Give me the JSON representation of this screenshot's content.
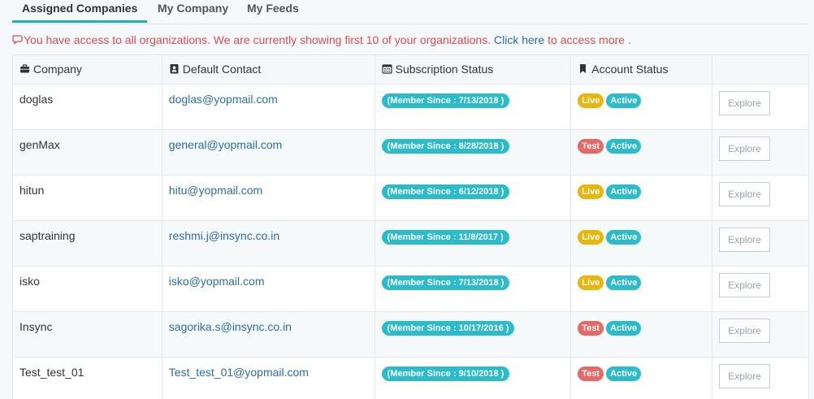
{
  "tabs": [
    {
      "label": "Assigned Companies",
      "active": true
    },
    {
      "label": "My Company",
      "active": false
    },
    {
      "label": "My Feeds",
      "active": false
    }
  ],
  "notice": {
    "text": "You have access to all organizations. We are currently showing first 10 of your organizations.",
    "link_text": "Click here",
    "suffix": "to access more ."
  },
  "table": {
    "headers": {
      "company": "Company",
      "contact": "Default Contact",
      "subscription": "Subscription Status",
      "account": "Account Status",
      "action": ""
    },
    "rows": [
      {
        "company": "doglas",
        "email": "doglas@yopmail.com",
        "member": "(Member Since : 7/13/2018 )",
        "env": "Live",
        "status": "Active",
        "action": "Explore"
      },
      {
        "company": "genMax",
        "email": "general@yopmail.com",
        "member": "(Member Since : 8/28/2018 )",
        "env": "Test",
        "status": "Active",
        "action": "Explore"
      },
      {
        "company": "hitun",
        "email": "hitu@yopmail.com",
        "member": "(Member Since : 6/12/2018 )",
        "env": "Live",
        "status": "Active",
        "action": "Explore"
      },
      {
        "company": "saptraining",
        "email": "reshmi.j@insync.co.in",
        "member": "(Member Since : 11/8/2017 )",
        "env": "Live",
        "status": "Active",
        "action": "Explore"
      },
      {
        "company": "isko",
        "email": "isko@yopmail.com",
        "member": "(Member Since : 7/13/2018 )",
        "env": "Live",
        "status": "Active",
        "action": "Explore"
      },
      {
        "company": "Insync",
        "email": "sagorika.s@insync.co.in",
        "member": "(Member Since : 10/17/2016 )",
        "env": "Test",
        "status": "Active",
        "action": "Explore"
      },
      {
        "company": "Test_test_01",
        "email": "Test_test_01@yopmail.com",
        "member": "(Member Since : 9/10/2018 )",
        "env": "Test",
        "status": "Active",
        "action": "Explore"
      }
    ]
  },
  "colors": {
    "accent": "#1ab0c8",
    "live": "#e9b60c",
    "test": "#e86767",
    "active": "#2bbccc",
    "link": "#2b6ea8",
    "notice": "#e34b4b"
  },
  "icons": {
    "notice": "comments-icon",
    "company": "briefcase-icon",
    "contact": "contact-card-icon",
    "subscription": "calendar-icon",
    "account": "bookmark-icon"
  }
}
